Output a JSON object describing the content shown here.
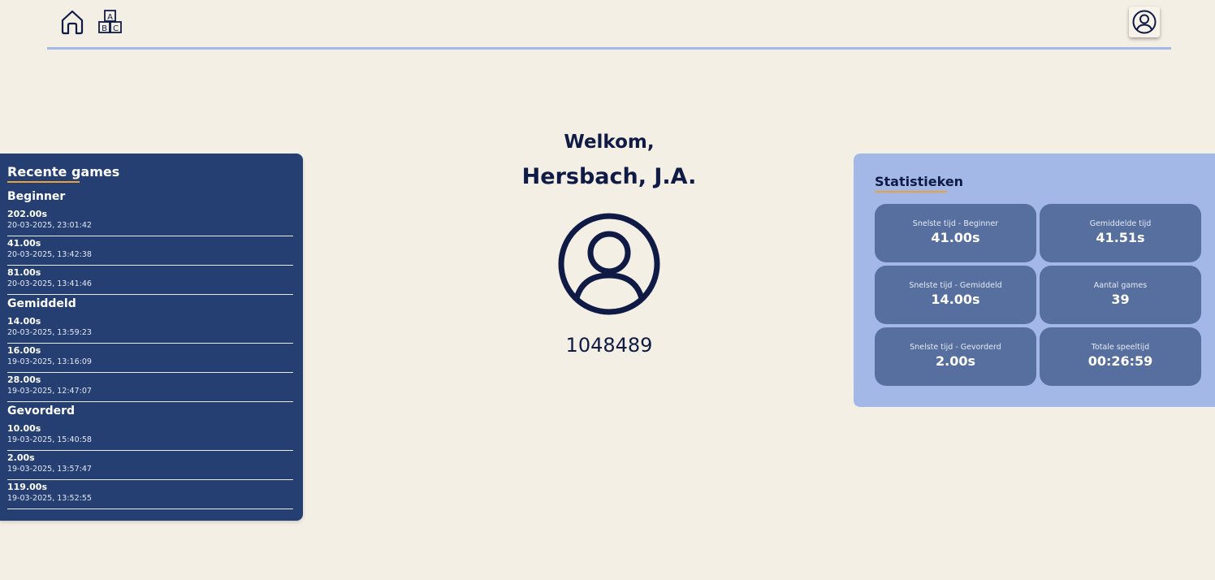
{
  "nav": {
    "home_icon": "home-icon",
    "abc_icon": "abc-blocks-icon",
    "profile_icon": "user-circle-icon",
    "abc_letters": [
      "A",
      "B",
      "C"
    ]
  },
  "colors": {
    "background": "#f4efe4",
    "nav_line": "#a3b8e6",
    "recent_panel": "#253f73",
    "stats_panel": "#a3b8e6",
    "stat_card": "#566f9f",
    "accent_underline": "#e8a23c",
    "text_dark": "#0f1b45"
  },
  "recent": {
    "title": "Recente games",
    "levels": [
      {
        "name": "Beginner",
        "games": [
          {
            "time": "202.00s",
            "date": "20-03-2025, 23:01:42"
          },
          {
            "time": "41.00s",
            "date": "20-03-2025, 13:42:38"
          },
          {
            "time": "81.00s",
            "date": "20-03-2025, 13:41:46"
          }
        ]
      },
      {
        "name": "Gemiddeld",
        "games": [
          {
            "time": "14.00s",
            "date": "20-03-2025, 13:59:23"
          },
          {
            "time": "16.00s",
            "date": "19-03-2025, 13:16:09"
          },
          {
            "time": "28.00s",
            "date": "19-03-2025, 12:47:07"
          }
        ]
      },
      {
        "name": "Gevorderd",
        "games": [
          {
            "time": "10.00s",
            "date": "19-03-2025, 15:40:58"
          },
          {
            "time": "2.00s",
            "date": "19-03-2025, 13:57:47"
          },
          {
            "time": "119.00s",
            "date": "19-03-2025, 13:52:55"
          }
        ]
      }
    ]
  },
  "profile": {
    "welcome": "Welkom,",
    "name": "Hersbach, J.A.",
    "avatar_icon": "user-circle-icon",
    "number": "1048489"
  },
  "stats": {
    "title": "Statistieken",
    "cards": [
      {
        "label": "Snelste tijd - Beginner",
        "value": "41.00s"
      },
      {
        "label": "Gemiddelde tijd",
        "value": "41.51s"
      },
      {
        "label": "Snelste tijd - Gemiddeld",
        "value": "14.00s"
      },
      {
        "label": "Aantal games",
        "value": "39"
      },
      {
        "label": "Snelste tijd - Gevorderd",
        "value": "2.00s"
      },
      {
        "label": "Totale speeltijd",
        "value": "00:26:59"
      }
    ]
  }
}
